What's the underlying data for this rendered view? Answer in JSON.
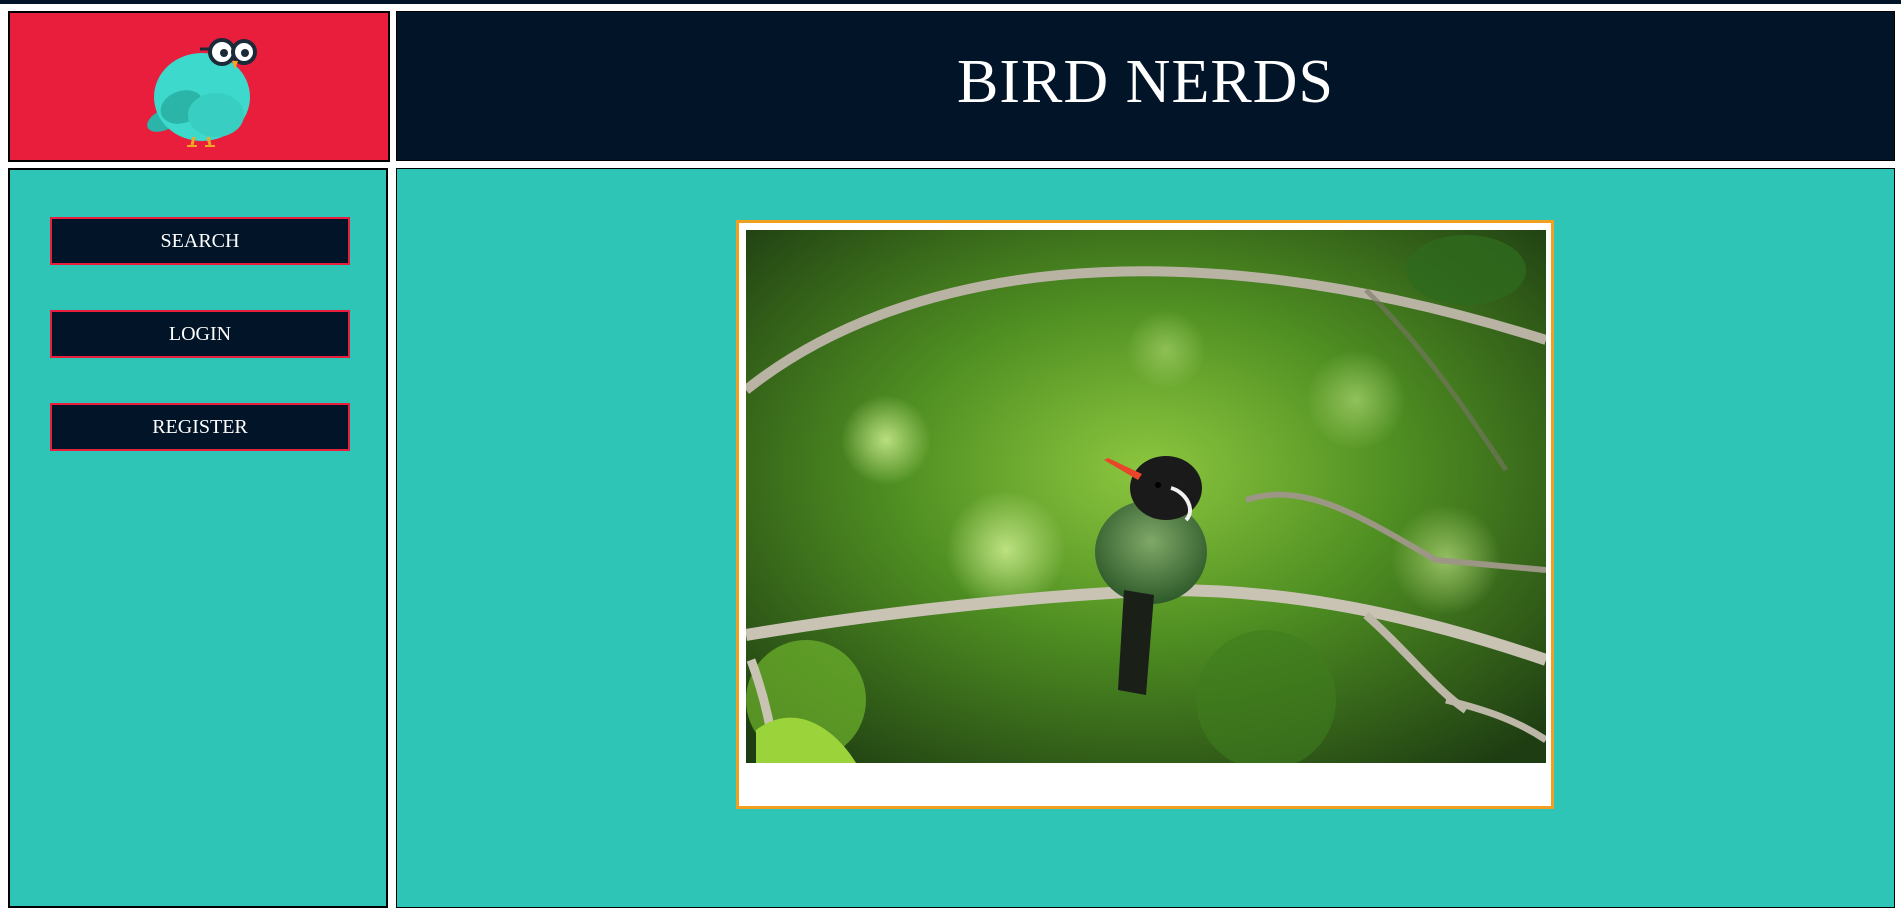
{
  "header": {
    "logo_icon": "owl-bird-logo",
    "title": "BIRD NERDS"
  },
  "sidebar": {
    "items": [
      {
        "label": "SEARCH"
      },
      {
        "label": "LOGIN"
      },
      {
        "label": "REGISTER"
      }
    ]
  },
  "main": {
    "photo_subject": "hummingbird-on-branch",
    "photo_caption": ""
  },
  "colors": {
    "brand_red": "#e81e3c",
    "navy": "#021428",
    "teal": "#2ec4b6",
    "frame_gold": "#f0a020"
  }
}
